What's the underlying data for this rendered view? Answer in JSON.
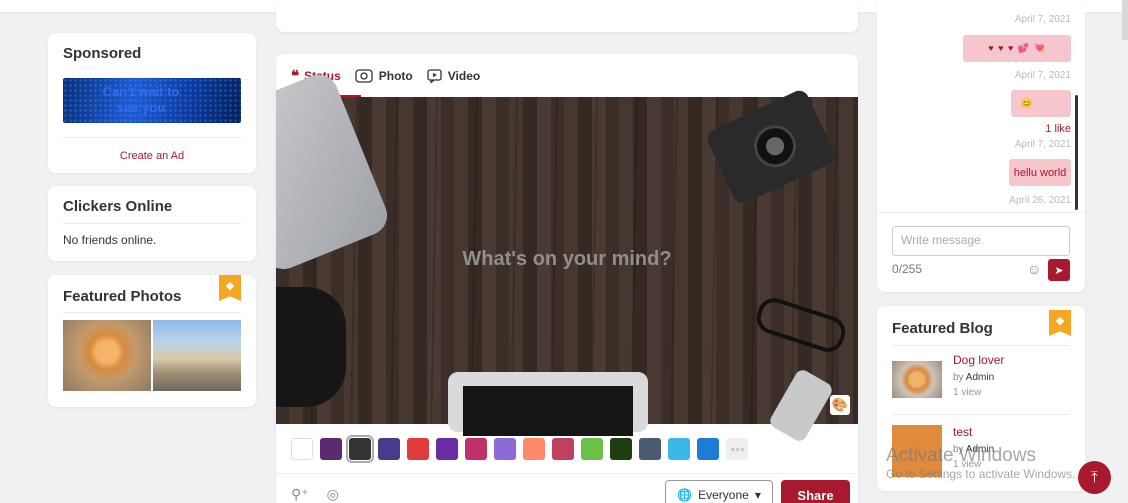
{
  "sponsored": {
    "title": "Sponsored",
    "ad_text": "Can't wait to see you",
    "create_ad": "Create an Ad"
  },
  "clickers": {
    "title": "Clickers Online",
    "empty_text": "No friends online."
  },
  "featured_photos": {
    "title": "Featured Photos",
    "badge_icon": "diamond-icon"
  },
  "composer": {
    "tabs": [
      {
        "label": "Status",
        "icon": "quote-icon",
        "active": true
      },
      {
        "label": "Photo",
        "icon": "photo-icon",
        "active": false
      },
      {
        "label": "Video",
        "icon": "video-icon",
        "active": false
      }
    ],
    "placeholder": "What's on your mind?",
    "privacy": "Everyone",
    "share": "Share",
    "swatch_colors": [
      "#ffffff",
      "#5c2a6e",
      "#333333",
      "#4a3a8c",
      "#e03a3a",
      "#6a2ca3",
      "#c0306a",
      "#8e6ad8",
      "#ff8a6a",
      "#c04060",
      "#6bc04a",
      "#1e3e10",
      "#4a5a70",
      "#3ab8e8",
      "#1f7ad8"
    ]
  },
  "chat": {
    "messages": [
      {
        "time": "April 7, 2021"
      },
      {
        "text": "♥ ♥ ♥ 💕 💘",
        "time": "April 7, 2021"
      },
      {
        "text": "😊",
        "likes": "1 like",
        "time": "April 7, 2021"
      },
      {
        "text": "hellu world",
        "time": "April 26, 2021"
      }
    ],
    "input_placeholder": "Write message",
    "counter": "0/255"
  },
  "featured_blog": {
    "title": "Featured Blog",
    "items": [
      {
        "title": "Dog lover",
        "by": "by",
        "author": "Admin",
        "views": "1 view"
      },
      {
        "title": "test",
        "by": "by",
        "author": "Admin",
        "views": "1 view"
      }
    ]
  },
  "watermark": {
    "line1": "Activate Windows",
    "line2": "Go to Settings to activate Windows."
  },
  "colors": {
    "accent": "#a8192e",
    "badge": "#f5a623"
  }
}
